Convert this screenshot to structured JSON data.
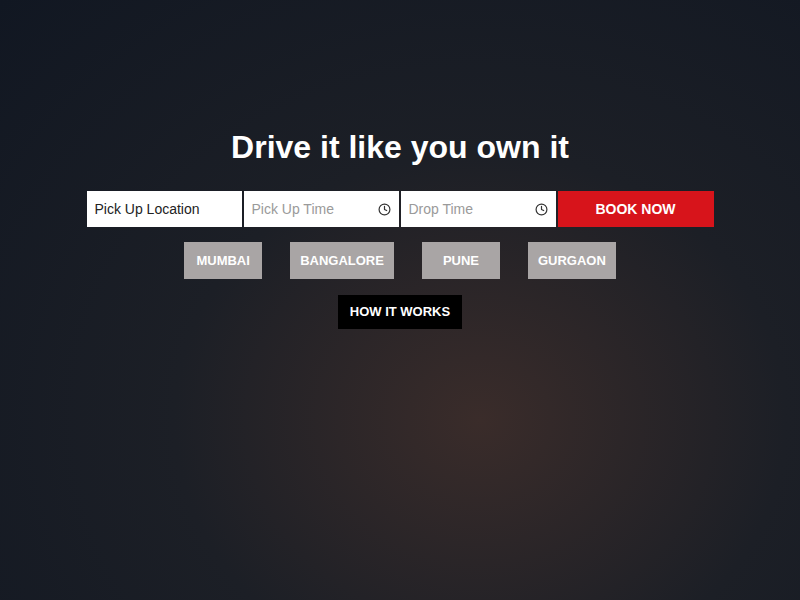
{
  "hero": {
    "heading": "Drive it like you own it"
  },
  "booking_form": {
    "fields": [
      {
        "placeholder": "Pick Up Location",
        "kind": "location"
      },
      {
        "placeholder": "Pick Up Time",
        "kind": "time"
      },
      {
        "placeholder": "Drop Time",
        "kind": "time"
      }
    ],
    "submit": "BOOK NOW"
  },
  "cities": [
    "MUMBAI",
    "BANGALORE",
    "PUNE",
    "GURGAON"
  ],
  "how_it_works": "HOW IT WORKS"
}
